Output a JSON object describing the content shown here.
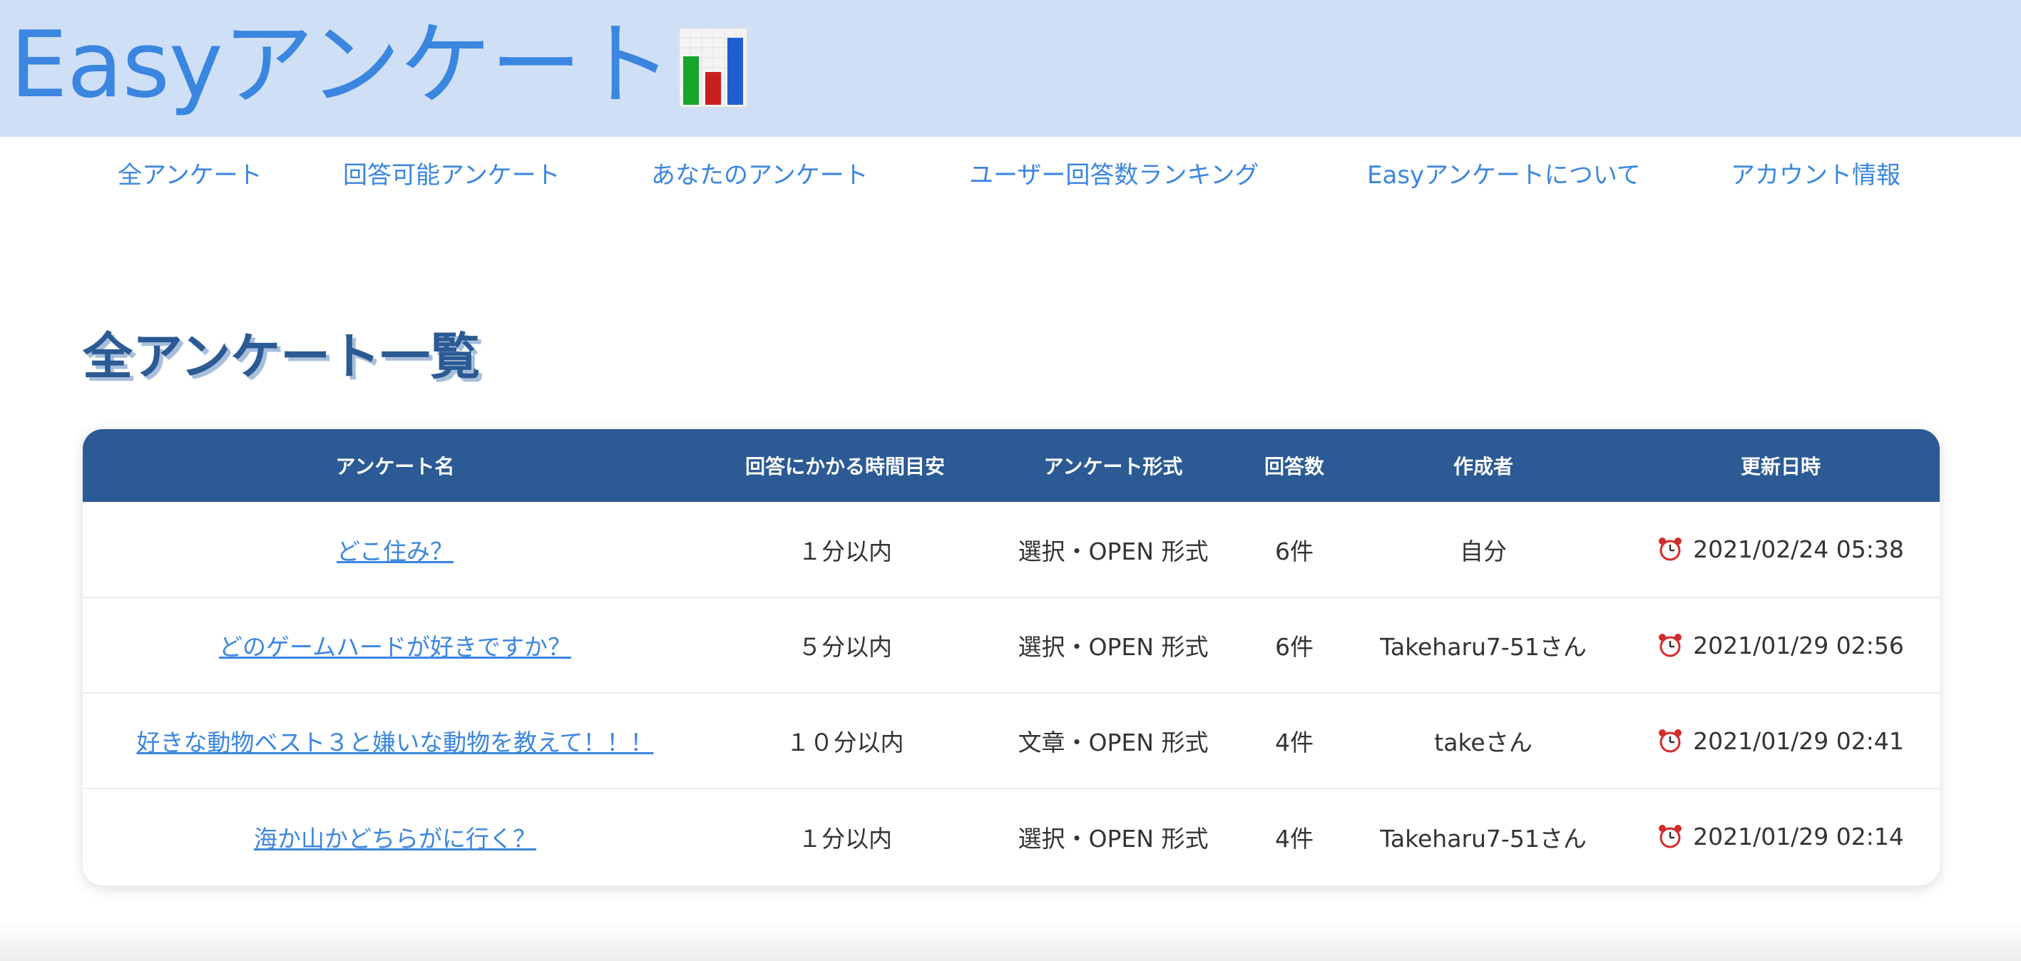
{
  "site": {
    "title": "Easyアンケート",
    "logo_icon": "bar-chart-icon"
  },
  "nav": {
    "items": [
      {
        "label": "全アンケート"
      },
      {
        "label": "回答可能アンケート"
      },
      {
        "label": "あなたのアンケート"
      },
      {
        "label": "ユーザー回答数ランキング"
      },
      {
        "label": "Easyアンケートについて"
      },
      {
        "label": "アカウント情報"
      }
    ]
  },
  "main": {
    "heading": "全アンケート一覧"
  },
  "table": {
    "headers": [
      "アンケート名",
      "回答にかかる時間目安",
      "アンケート形式",
      "回答数",
      "作成者",
      "更新日時"
    ],
    "rows": [
      {
        "name": "どこ住み？",
        "time": "１分以内",
        "format": "選択・OPEN 形式",
        "count": "6件",
        "author": "自分",
        "updated": "2021/02/24 05:38"
      },
      {
        "name": "どのゲームハードが好きですか？",
        "time": "５分以内",
        "format": "選択・OPEN 形式",
        "count": "6件",
        "author": "Takeharu7-51さん",
        "updated": "2021/01/29 02:56"
      },
      {
        "name": "好きな動物ベスト３と嫌いな動物を教えて！！！",
        "time": "１０分以内",
        "format": "文章・OPEN 形式",
        "count": "4件",
        "author": "takeさん",
        "updated": "2021/01/29 02:41"
      },
      {
        "name": "海か山かどちらがに行く？",
        "time": "１分以内",
        "format": "選択・OPEN 形式",
        "count": "4件",
        "author": "Takeharu7-51さん",
        "updated": "2021/01/29 02:14"
      }
    ],
    "updated_icon": "alarm-clock-icon"
  },
  "colors": {
    "header_bg": "#cfe0f6",
    "link": "#3b86e0",
    "table_header_bg": "#2b5a94",
    "heading": "#2b5a94"
  }
}
